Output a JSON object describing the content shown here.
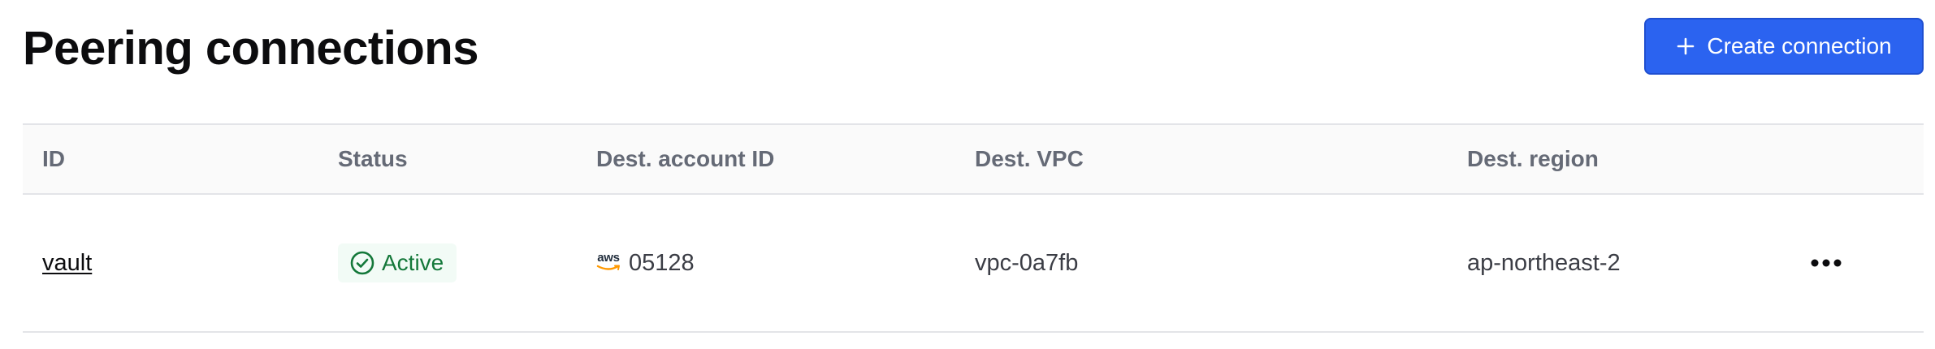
{
  "header": {
    "title": "Peering connections",
    "create_button_label": "Create connection"
  },
  "table": {
    "columns": [
      "ID",
      "Status",
      "Dest. account ID",
      "Dest. VPC",
      "Dest. region"
    ],
    "rows": [
      {
        "id": "vault",
        "status": "Active",
        "provider_logo": "aws",
        "dest_account_id": "05128",
        "dest_vpc": "vpc-0a7fb",
        "dest_region": "ap-northeast-2"
      }
    ]
  },
  "icons": {
    "create": "plus-icon",
    "status": "check-circle-icon",
    "provider": "aws-logo-icon",
    "row_actions": "more-horizontal-icon"
  },
  "colors": {
    "primary_button": "#2b63f0",
    "status_active_text": "#14783a",
    "status_active_bg": "#f2fbf6",
    "header_text": "#656a76",
    "aws_smile": "#ff9900"
  }
}
